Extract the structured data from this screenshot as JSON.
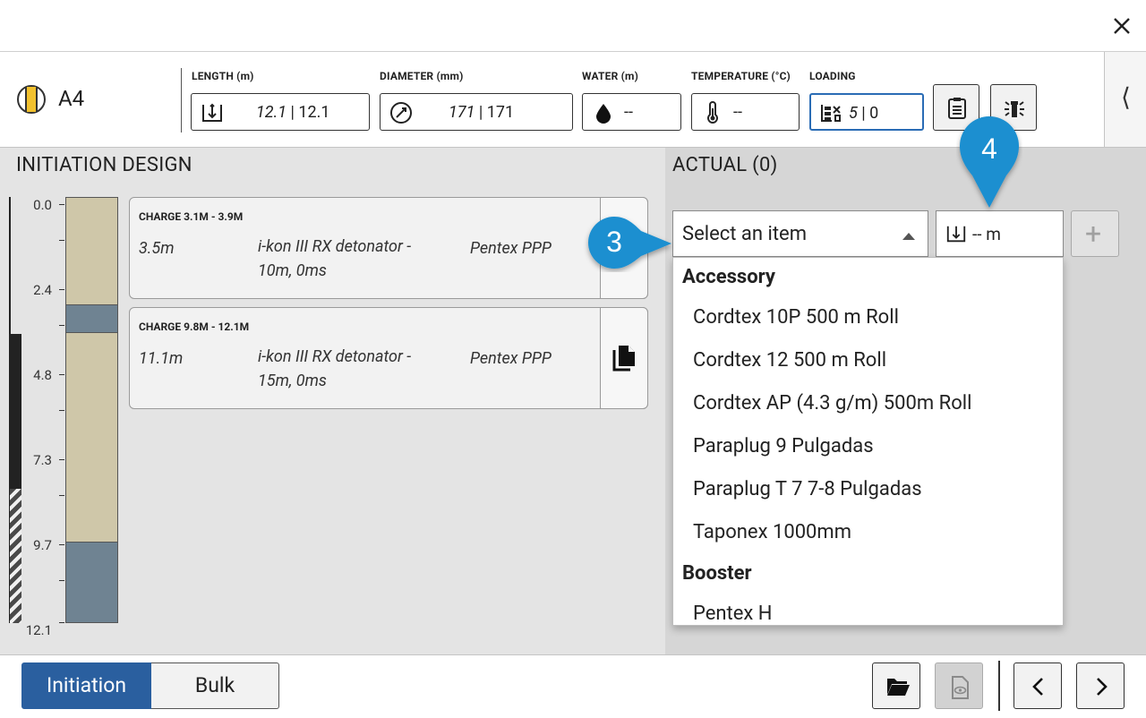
{
  "hole": {
    "name": "A4",
    "icon": "hole-status-icon"
  },
  "fields": {
    "length": {
      "label": "LENGTH (m)",
      "design": "12.1",
      "actual": " | 12.1",
      "icon": "hole-length-icon"
    },
    "diameter": {
      "label": "DIAMETER (mm)",
      "design": "171",
      "actual": " | 171",
      "icon": "diameter-icon"
    },
    "water": {
      "label": "WATER (m)",
      "value": "--",
      "icon": "water-drop-icon"
    },
    "temperature": {
      "label": "TEMPERATURE (°C)",
      "value": "--",
      "icon": "thermometer-icon"
    },
    "loading": {
      "label": "LOADING",
      "design": "5",
      "actual": " | 0",
      "icon": "loading-icon"
    }
  },
  "initiation_design": {
    "title": "INITIATION DESIGN",
    "depth_labels": [
      "0.0",
      "2.4",
      "4.8",
      "7.3",
      "9.7",
      "12.1"
    ],
    "charges": [
      {
        "title": "CHARGE 3.1M - 3.9M",
        "depth": "3.5m",
        "detonator": "i-kon III RX detonator - 10m, 0ms",
        "booster": "Pentex PPP"
      },
      {
        "title": "CHARGE 9.8M - 12.1M",
        "depth": "11.1m",
        "detonator": "i-kon III RX detonator - 15m, 0ms",
        "booster": "Pentex PPP"
      }
    ]
  },
  "actual": {
    "title": "ACTUAL (0)",
    "select_placeholder": "Select an item",
    "length_value": "-- m",
    "add_label": "+",
    "dropdown": {
      "groups": [
        {
          "label": "Accessory",
          "items": [
            "Cordtex 10P 500 m Roll",
            "Cordtex 12 500 m Roll",
            "Cordtex AP (4.3 g/m) 500m Roll",
            "Paraplug 9 Pulgadas",
            "Paraplug T 7 7-8 Pulgadas",
            "Taponex 1000mm"
          ]
        },
        {
          "label": "Booster",
          "items": [
            "Pentex H"
          ]
        }
      ]
    }
  },
  "callouts": {
    "c3": "3",
    "c4": "4"
  },
  "footer": {
    "tab_initiation": "Initiation",
    "tab_bulk": "Bulk"
  },
  "colors": {
    "accent": "#2a5f9f",
    "callout": "#1a8fd0",
    "stemming": "#cfc7a9",
    "charge": "#6f8392"
  }
}
